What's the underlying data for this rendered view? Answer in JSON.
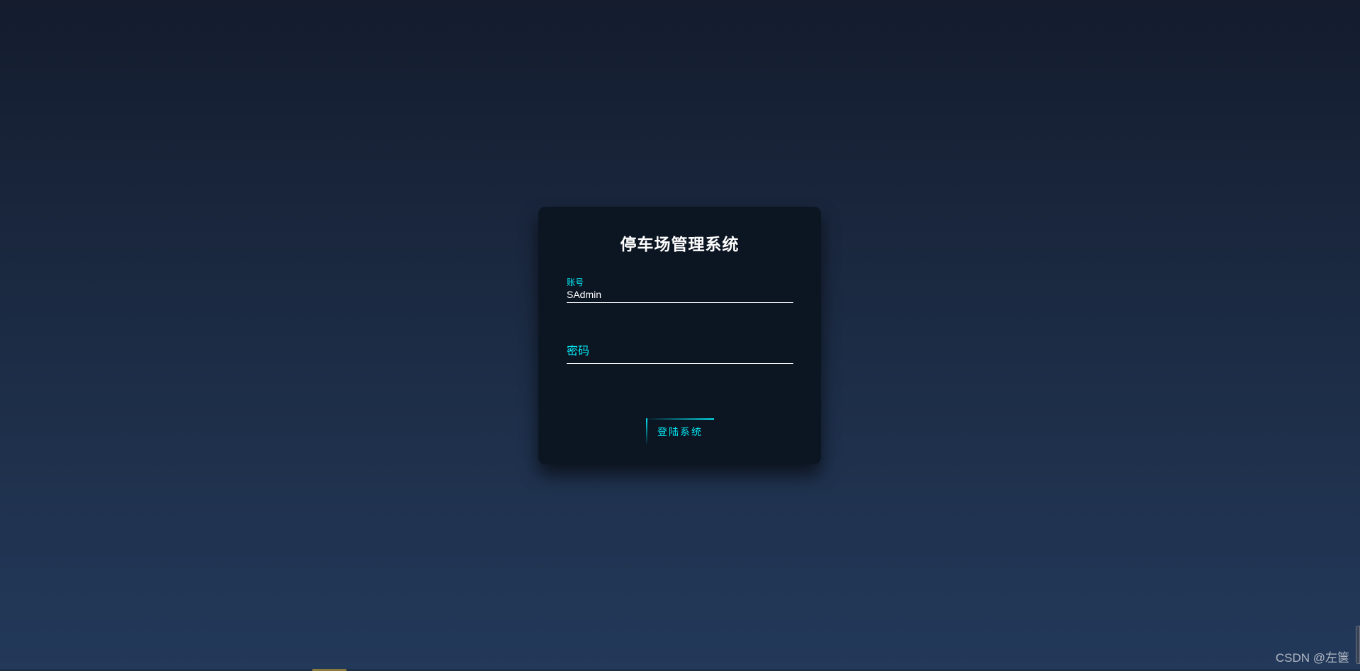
{
  "login": {
    "title": "停车场管理系统",
    "username": {
      "label": "账号",
      "value": "SAdmin"
    },
    "password": {
      "label": "密码",
      "value": ""
    },
    "submit_label": "登陆系统"
  },
  "watermark": "CSDN @左箧",
  "colors": {
    "accent": "#03e9f4",
    "card_background": "#0c1522",
    "page_gradient_top": "#141c2e",
    "page_gradient_bottom": "#23395a"
  }
}
